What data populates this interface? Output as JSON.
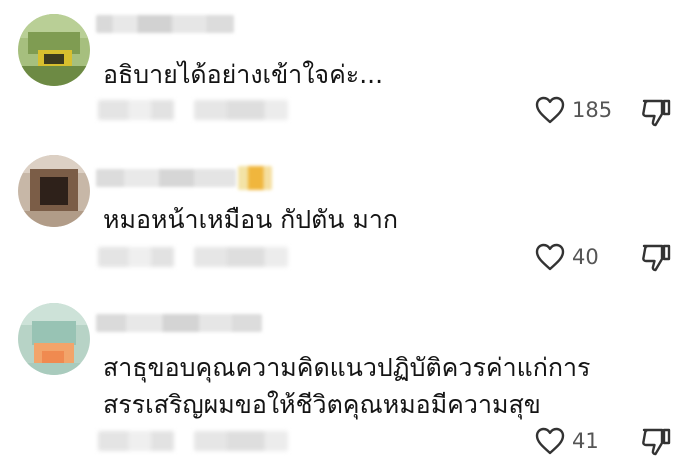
{
  "comments": [
    {
      "text": "อธิบายได้อย่างเข้าใจค่ะ...",
      "like_count": "185"
    },
    {
      "text": "หมอหน้าเหมือน กัปตัน มาก",
      "like_count": "40"
    },
    {
      "text_line1": "สาธุขอบคุณความคิดแนวปฏิบัติควรค่าแก่การ",
      "text_line2": "สรรเสริญผมขอให้ชีวิตคุณหมอมีความสุข",
      "like_count": "41"
    }
  ],
  "icons": {
    "like": "heart-outline-icon",
    "dislike": "thumbs-down-outline-icon"
  },
  "colors": {
    "text": "#141414",
    "count": "#555555",
    "icon": "#333333"
  }
}
